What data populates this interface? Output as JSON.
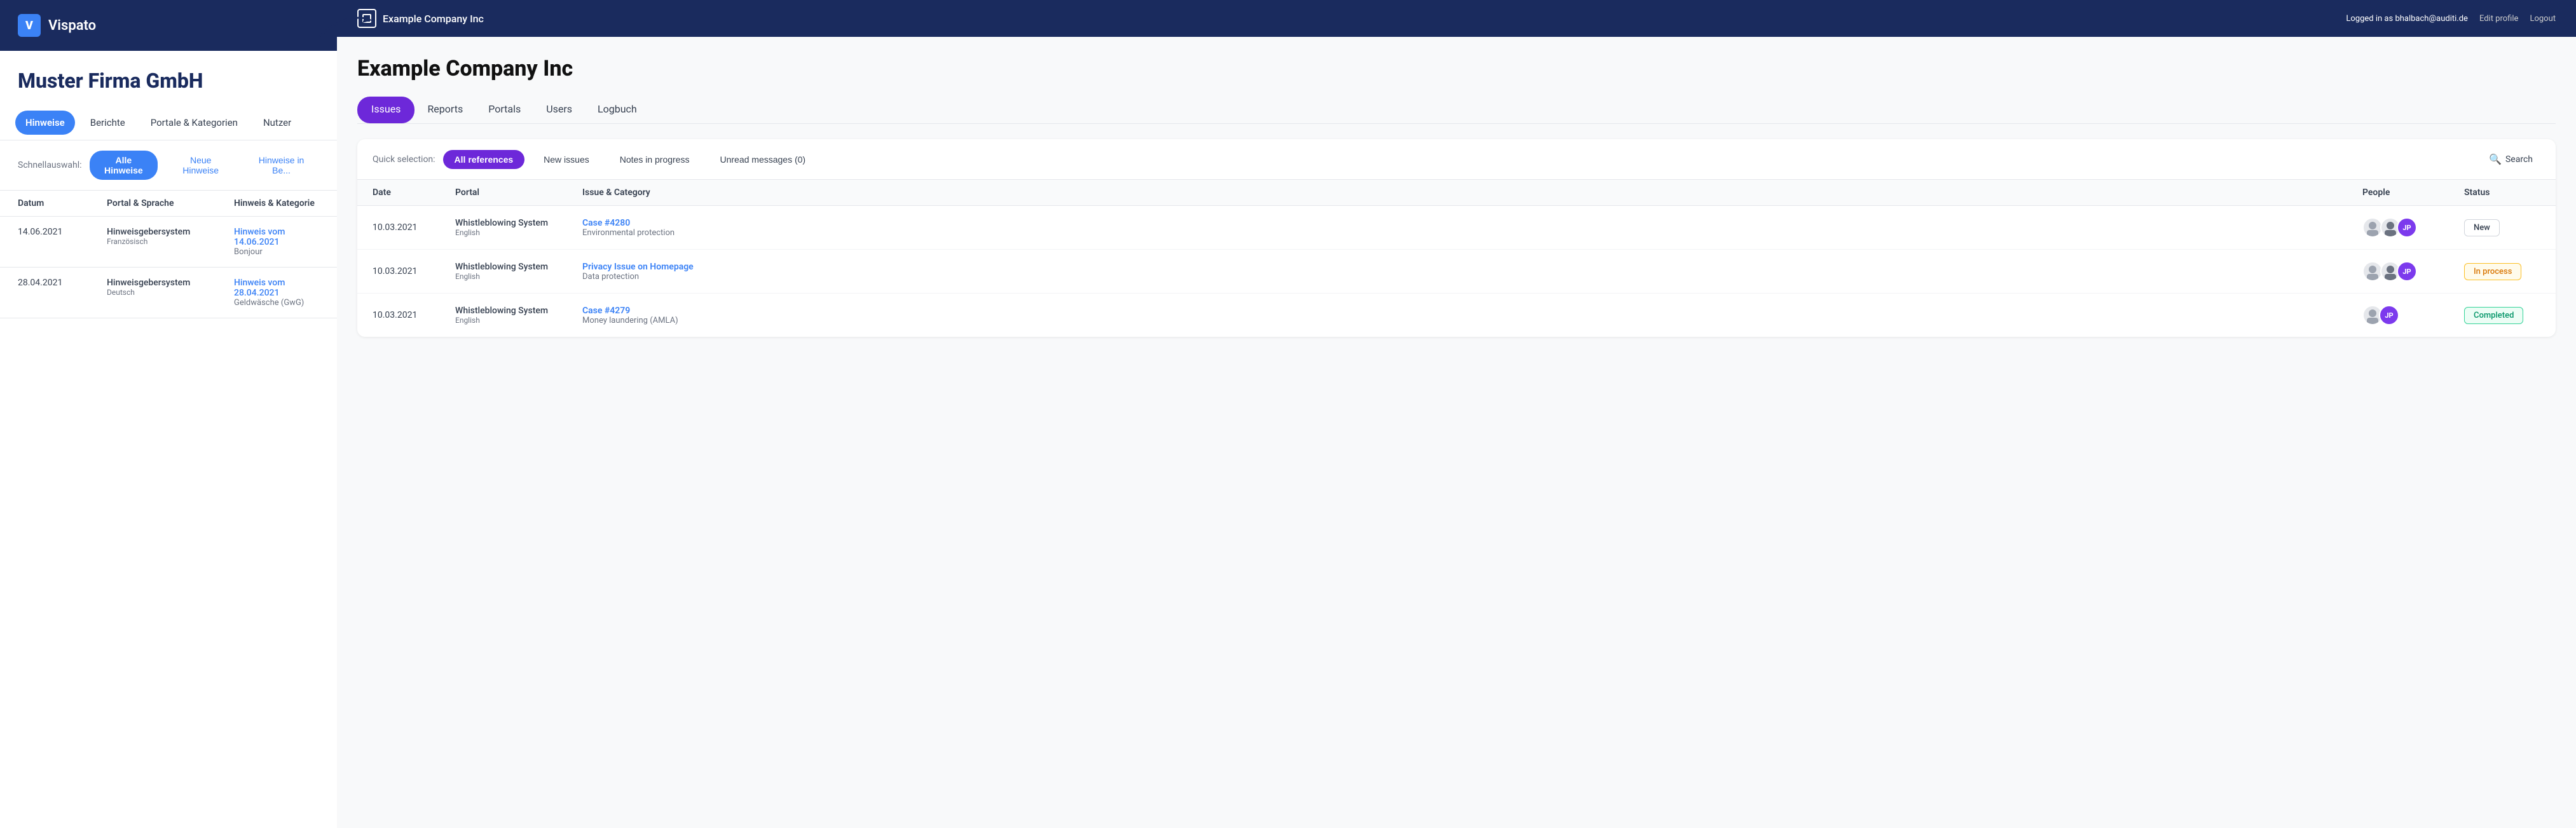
{
  "left": {
    "header": {
      "logo_letter": "V",
      "brand": "Vispato"
    },
    "company_title": "Muster Firma GmbH",
    "nav": [
      {
        "label": "Hinweise",
        "active": true
      },
      {
        "label": "Berichte",
        "active": false
      },
      {
        "label": "Portale & Kategorien",
        "active": false
      },
      {
        "label": "Nutzer",
        "active": false
      }
    ],
    "schnellauswahl": {
      "label": "Schnellauswahl:",
      "buttons": [
        {
          "label": "Alle Hinweise",
          "active": true
        },
        {
          "label": "Neue Hinweise",
          "active": false
        },
        {
          "label": "Hinweise in Be...",
          "active": false
        }
      ]
    },
    "table": {
      "headers": [
        "Datum",
        "Portal & Sprache",
        "Hinweis & Kategorie"
      ],
      "rows": [
        {
          "date": "14.06.2021",
          "portal": "Hinweisgebersystem",
          "lang": "Französisch",
          "issue_link": "Hinweis vom 14.06.2021",
          "issue_sub": "Bonjour"
        },
        {
          "date": "28.04.2021",
          "portal": "Hinweisgebersystem",
          "lang": "Deutsch",
          "issue_link": "Hinweis vom 28.04.2021",
          "issue_sub": "Geldwäsche (GwG)"
        }
      ]
    }
  },
  "right": {
    "topbar": {
      "brand": "Example Company Inc",
      "logged_in_text": "Logged in as",
      "user_email": "bhalbach@auditi.de",
      "edit_profile": "Edit profile",
      "logout": "Logout"
    },
    "company_title": "Example Company Inc",
    "nav": [
      {
        "label": "Issues",
        "active": true
      },
      {
        "label": "Reports",
        "active": false
      },
      {
        "label": "Portals",
        "active": false
      },
      {
        "label": "Users",
        "active": false
      },
      {
        "label": "Logbuch",
        "active": false
      }
    ],
    "quick_selection": {
      "label": "Quick selection:",
      "buttons": [
        {
          "label": "All references",
          "active": true
        },
        {
          "label": "New issues",
          "active": false
        },
        {
          "label": "Notes in progress",
          "active": false
        },
        {
          "label": "Unread messages (0)",
          "active": false
        }
      ],
      "search_label": "Search"
    },
    "table": {
      "headers": [
        "Date",
        "Portal",
        "Issue & Category",
        "People",
        "Status"
      ],
      "rows": [
        {
          "date": "10.03.2021",
          "portal": "Whistleblowing System",
          "portal_lang": "English",
          "issue_link": "Case #4280",
          "category": "Environmental protection",
          "status": "New",
          "status_class": "status-new"
        },
        {
          "date": "10.03.2021",
          "portal": "Whistleblowing System",
          "portal_lang": "English",
          "issue_link": "Privacy Issue on Homepage",
          "category": "Data protection",
          "status": "In process",
          "status_class": "status-in-process"
        },
        {
          "date": "10.03.2021",
          "portal": "Whistleblowing System",
          "portal_lang": "English",
          "issue_link": "Case #4279",
          "category": "Money laundering (AMLA)",
          "status": "Completed",
          "status_class": "status-completed"
        }
      ]
    }
  }
}
